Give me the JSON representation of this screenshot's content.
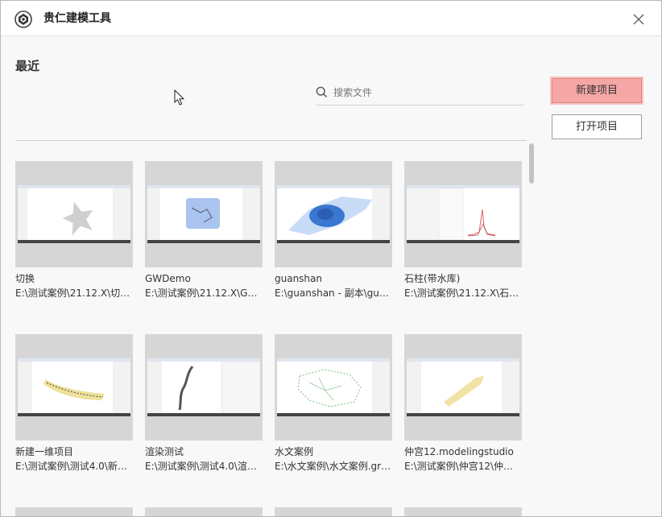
{
  "window": {
    "title": "贵仁建模工具"
  },
  "main": {
    "section_title": "最近",
    "search": {
      "placeholder": "搜索文件",
      "value": ""
    }
  },
  "actions": {
    "new_project": "新建项目",
    "open_project": "打开项目"
  },
  "projects": [
    {
      "name": "切换",
      "path": "E:\\测试案例\\21.12.X\\切…"
    },
    {
      "name": "GWDemo",
      "path": "E:\\测试案例\\21.12.X\\GW…"
    },
    {
      "name": "guanshan",
      "path": "E:\\guanshan - 副本\\guan…"
    },
    {
      "name": "石柱(带水库)",
      "path": "E:\\测试案例\\21.12.X\\石…"
    },
    {
      "name": "新建一维项目",
      "path": "E:\\测试案例\\测试4.0\\新…"
    },
    {
      "name": "渲染测试",
      "path": "E:\\测试案例\\测试4.0\\渲…"
    },
    {
      "name": "水文案例",
      "path": "E:\\水文案例\\水文案例.gr…"
    },
    {
      "name": "仲宫12.modelingstudio",
      "path": "E:\\测试案例\\仲宫12\\仲宫…"
    }
  ],
  "colors": {
    "accent_button": "#f5a7a6",
    "accent_border": "#e08584"
  }
}
